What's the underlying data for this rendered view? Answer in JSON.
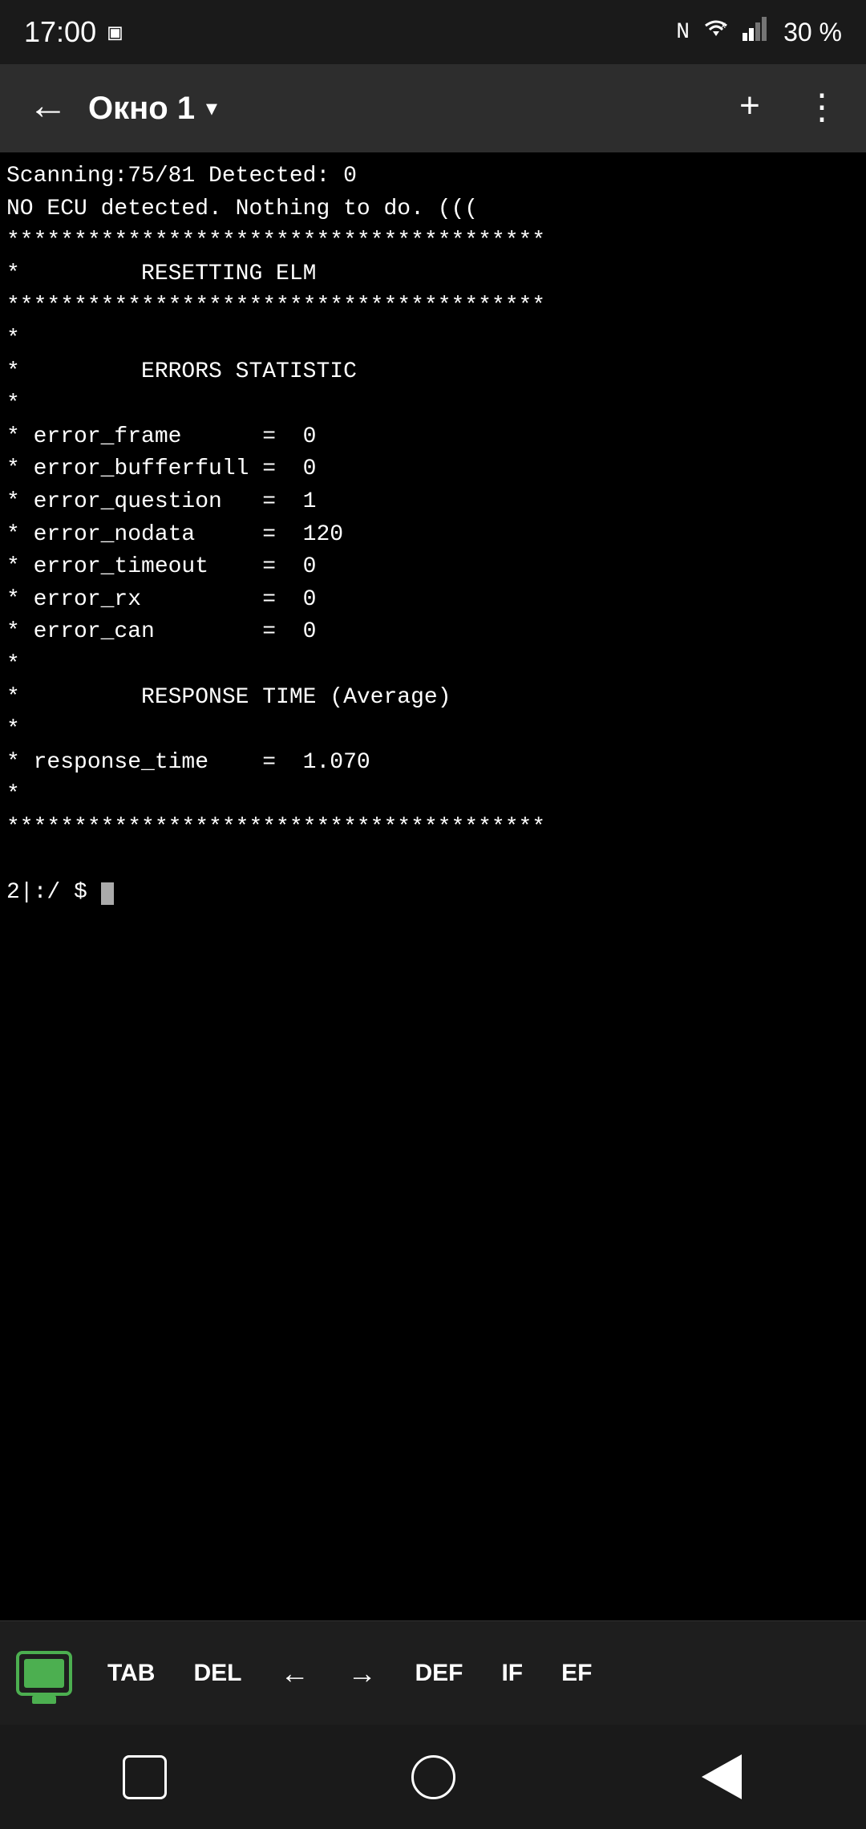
{
  "statusBar": {
    "time": "17:00",
    "battery": "30 %"
  },
  "toolbar": {
    "title": "Окно 1",
    "back_label": "←",
    "dropdown_label": "▾",
    "add_label": "+",
    "more_label": "⋮"
  },
  "terminal": {
    "lines": [
      "Scanning:75/81 Detected: 0",
      "NO ECU detected. Nothing to do. (((    ",
      "****************************************",
      "*         RESETTING ELM                ",
      "****************************************",
      "*                                      ",
      "*         ERRORS STATISTIC             ",
      "*                                      ",
      "* error_frame      =  0                ",
      "* error_bufferfull =  0                ",
      "* error_question   =  1                ",
      "* error_nodata     =  120              ",
      "* error_timeout    =  0                ",
      "* error_rx         =  0                ",
      "* error_can        =  0                ",
      "*                                      ",
      "*         RESPONSE TIME (Average)      ",
      "*                                      ",
      "* response_time    =  1.070            ",
      "*                                      ",
      "****************************************",
      "",
      "2|:/ $ "
    ],
    "prompt": "2|:/ $ "
  },
  "keyboardToolbar": {
    "tab_label": "TAB",
    "del_label": "DEL",
    "left_label": "←",
    "right_label": "→",
    "def_label": "DEF",
    "if_label": "IF",
    "ef_label": "EF"
  },
  "navBar": {
    "square_label": "□",
    "circle_label": "○",
    "triangle_label": "◁"
  }
}
